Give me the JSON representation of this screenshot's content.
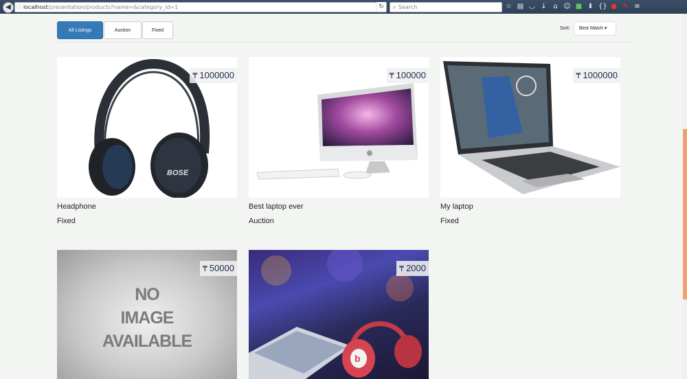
{
  "browser": {
    "url_host": "localhost",
    "url_path": "/presentation/products?name=&category_id=1",
    "search_placeholder": "Search"
  },
  "filters": [
    {
      "label": "All Listings",
      "active": true
    },
    {
      "label": "Auction",
      "active": false
    },
    {
      "label": "Fixed",
      "active": false
    }
  ],
  "sort": {
    "label": "Sort:",
    "value": "Best Match"
  },
  "currency_symbol": "₸",
  "products": [
    {
      "name": "Headphone",
      "type": "Fixed",
      "price": "1000000",
      "image": "bose-headphones"
    },
    {
      "name": "Best laptop ever",
      "type": "Auction",
      "price": "100000",
      "image": "imac-desktop"
    },
    {
      "name": "My laptop",
      "type": "Fixed",
      "price": "1000000",
      "image": "macbook-laptop"
    },
    {
      "name": "",
      "type": "",
      "price": "50000",
      "image": "no-image-placeholder",
      "image_text": [
        "NO",
        "IMAGE",
        "AVAILABLE"
      ]
    },
    {
      "name": "",
      "type": "",
      "price": "2000",
      "image": "beats-headphones-photo"
    }
  ]
}
